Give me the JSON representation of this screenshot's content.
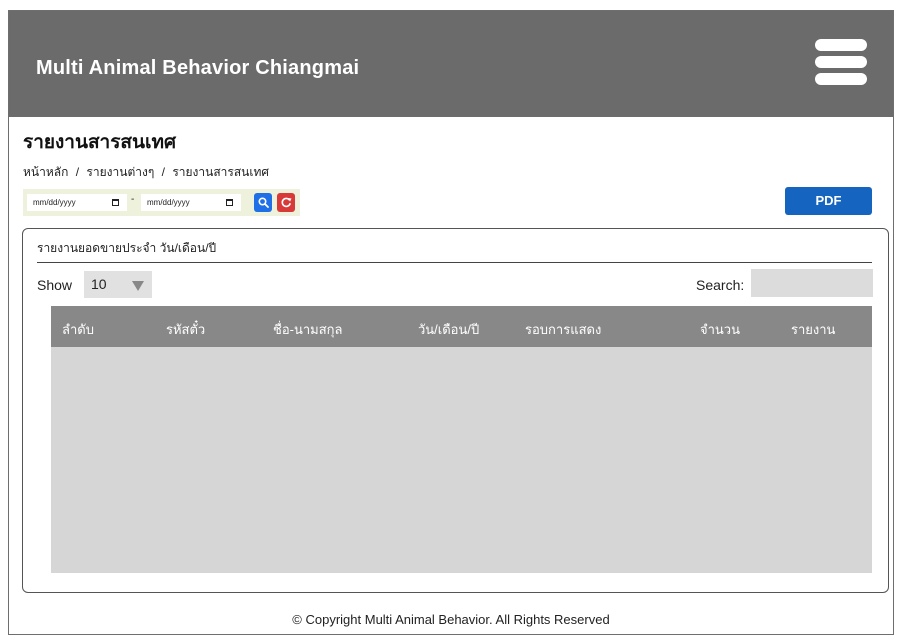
{
  "header": {
    "app_title": "Multi Animal Behavior Chiangmai",
    "menu_icon": "hamburger-menu-icon"
  },
  "page": {
    "title": "รายงานสารสนเทศ",
    "breadcrumb": [
      "หน้าหลัก",
      "รายงานต่างๆ",
      "รายงานสารสนเทศ"
    ],
    "breadcrumb_separator": "/"
  },
  "filter": {
    "date_from_placeholder": "mm/dd/yyyy",
    "date_to_placeholder": "mm/dd/yyyy",
    "range_separator": "-",
    "search_icon": "search-icon",
    "reset_icon": "refresh-icon"
  },
  "actions": {
    "pdf_label": "PDF"
  },
  "report": {
    "title": "รายงานยอดขายประจำ วัน/เดือน/ปี",
    "show_label": "Show",
    "page_length": "10",
    "search_label": "Search:",
    "search_value": "",
    "columns": [
      "ลำดับ",
      "รหัสตั๋ว",
      "ชื่อ-นามสกุล",
      "วัน/เดือน/ปี",
      "รอบการแสดง",
      "จำนวน",
      "รายงาน"
    ],
    "rows": []
  },
  "footer": {
    "text": "© Copyright Multi Animal Behavior. All Rights Reserved"
  },
  "colors": {
    "header_bg": "#6b6b6b",
    "table_header_bg": "#888888",
    "table_body_bg": "#d6d6d6",
    "pdf_button": "#1565c0",
    "search_button": "#1f6fe6",
    "reset_button": "#d83a3a",
    "filter_bar_bg": "#eef2dc"
  }
}
